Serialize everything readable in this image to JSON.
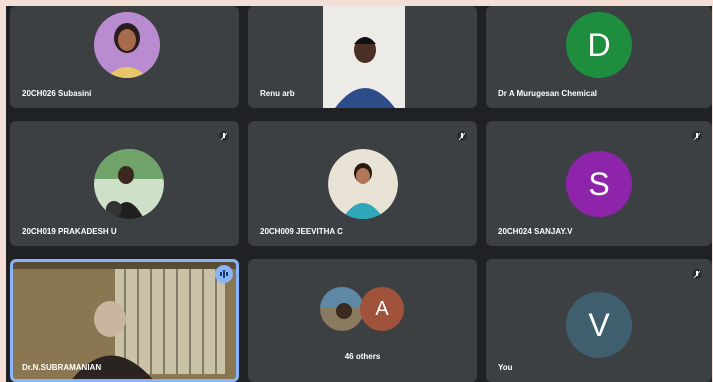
{
  "colors": {
    "tile_bg": "#3c4043",
    "grid_bg": "#202124",
    "accent": "#8ab4f8",
    "avatar_d": "#1e8e3e",
    "avatar_s": "#8e24aa",
    "avatar_v": "#3f5f6f",
    "avatar_a": "#a0523a"
  },
  "participants": [
    {
      "name": "20CH026 Subasini",
      "avatar": "photo",
      "muted": false
    },
    {
      "name": "Renu arb",
      "avatar": "video",
      "muted": false
    },
    {
      "name": "Dr A Murugesan Chemical",
      "avatar_letter": "D",
      "muted": false
    },
    {
      "name": "20CH019 PRAKADESH U",
      "avatar": "photo",
      "muted": true
    },
    {
      "name": "20CH009 JEEVITHA C",
      "avatar": "photo",
      "muted": true
    },
    {
      "name": "20CH024 SANJAY.V",
      "avatar_letter": "S",
      "muted": true
    },
    {
      "name": "Dr.N.SUBRAMANIAN",
      "avatar": "video",
      "speaking": true
    },
    {
      "others_label": "46 others",
      "avatar_letter": "A"
    },
    {
      "name": "You",
      "avatar_letter": "V",
      "muted": true
    }
  ],
  "icons": {
    "mute": "mic-off-icon",
    "speaking": "audio-wave-icon"
  }
}
